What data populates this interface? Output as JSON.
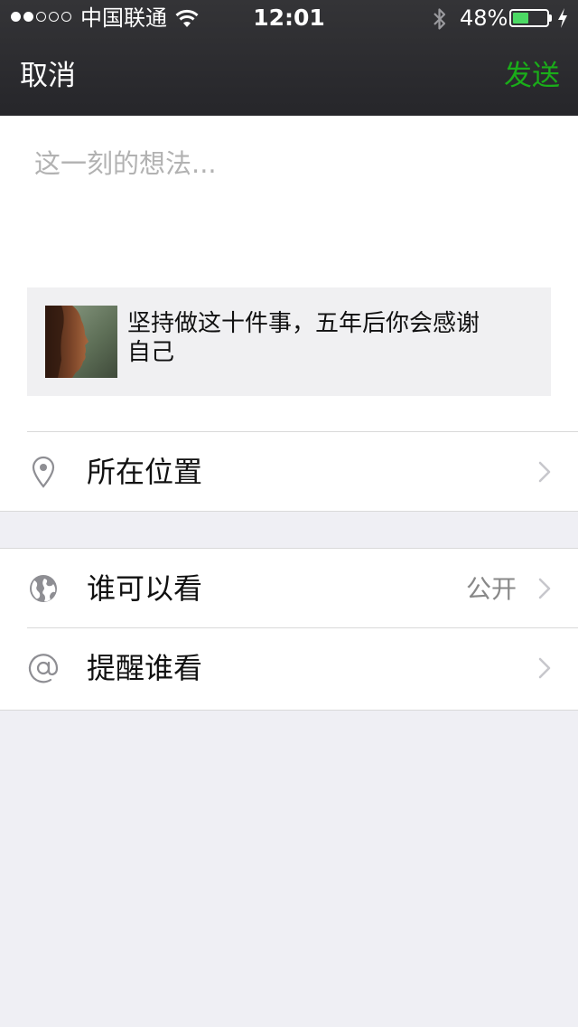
{
  "status_bar": {
    "signal_filled": 2,
    "signal_total": 5,
    "carrier": "中国联通",
    "time": "12:01",
    "battery_percent_text": "48%",
    "battery_level": 0.48,
    "battery_color": "#4cd964"
  },
  "nav": {
    "cancel_label": "取消",
    "send_label": "发送",
    "send_color": "#1aad19"
  },
  "compose": {
    "placeholder": "这一刻的想法...",
    "value": ""
  },
  "link_card": {
    "title": "坚持做这十件事，五年后你会感谢自己"
  },
  "rows": {
    "location": {
      "label": "所在位置",
      "icon": "location-pin-icon"
    },
    "visibility": {
      "label": "谁可以看",
      "value": "公开",
      "icon": "globe-icon"
    },
    "mention": {
      "label": "提醒谁看",
      "icon": "at-sign-icon"
    }
  }
}
